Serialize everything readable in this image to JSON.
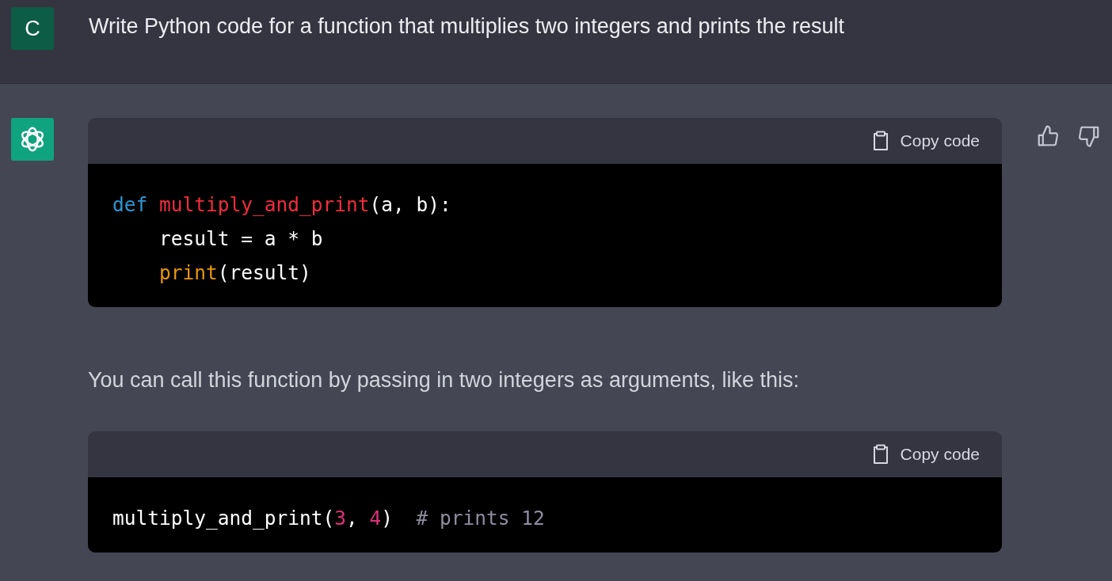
{
  "user_message": {
    "avatar": "C",
    "text": "Write Python code for a function that multiplies two integers and prints the result"
  },
  "assistant_message": {
    "blocks": [
      {
        "kind": "code",
        "copy_label": "Copy code",
        "lines": [
          {
            "indented": false,
            "tokens": [
              {
                "kind": "keyword",
                "text": "def"
              },
              {
                "kind": "function",
                "text": " multiply_and_print"
              },
              {
                "kind": "plain",
                "text": "(a, b):"
              }
            ]
          },
          {
            "indented": true,
            "tokens": [
              {
                "kind": "plain",
                "text": "result = a * b"
              }
            ]
          },
          {
            "indented": true,
            "tokens": [
              {
                "kind": "builtin",
                "text": "print"
              },
              {
                "kind": "plain",
                "text": "(result)"
              }
            ]
          }
        ]
      },
      {
        "kind": "paragraph",
        "text": "You can call this function by passing in two integers as arguments, like this:"
      },
      {
        "kind": "code",
        "copy_label": "Copy code",
        "lines": [
          {
            "indented": false,
            "tokens": [
              {
                "kind": "plain",
                "text": "multiply_and_print("
              },
              {
                "kind": "number",
                "text": "3"
              },
              {
                "kind": "plain",
                "text": ", "
              },
              {
                "kind": "number",
                "text": "4"
              },
              {
                "kind": "plain",
                "text": ")  "
              },
              {
                "kind": "comment",
                "text": "# prints 12"
              }
            ]
          }
        ]
      }
    ]
  }
}
